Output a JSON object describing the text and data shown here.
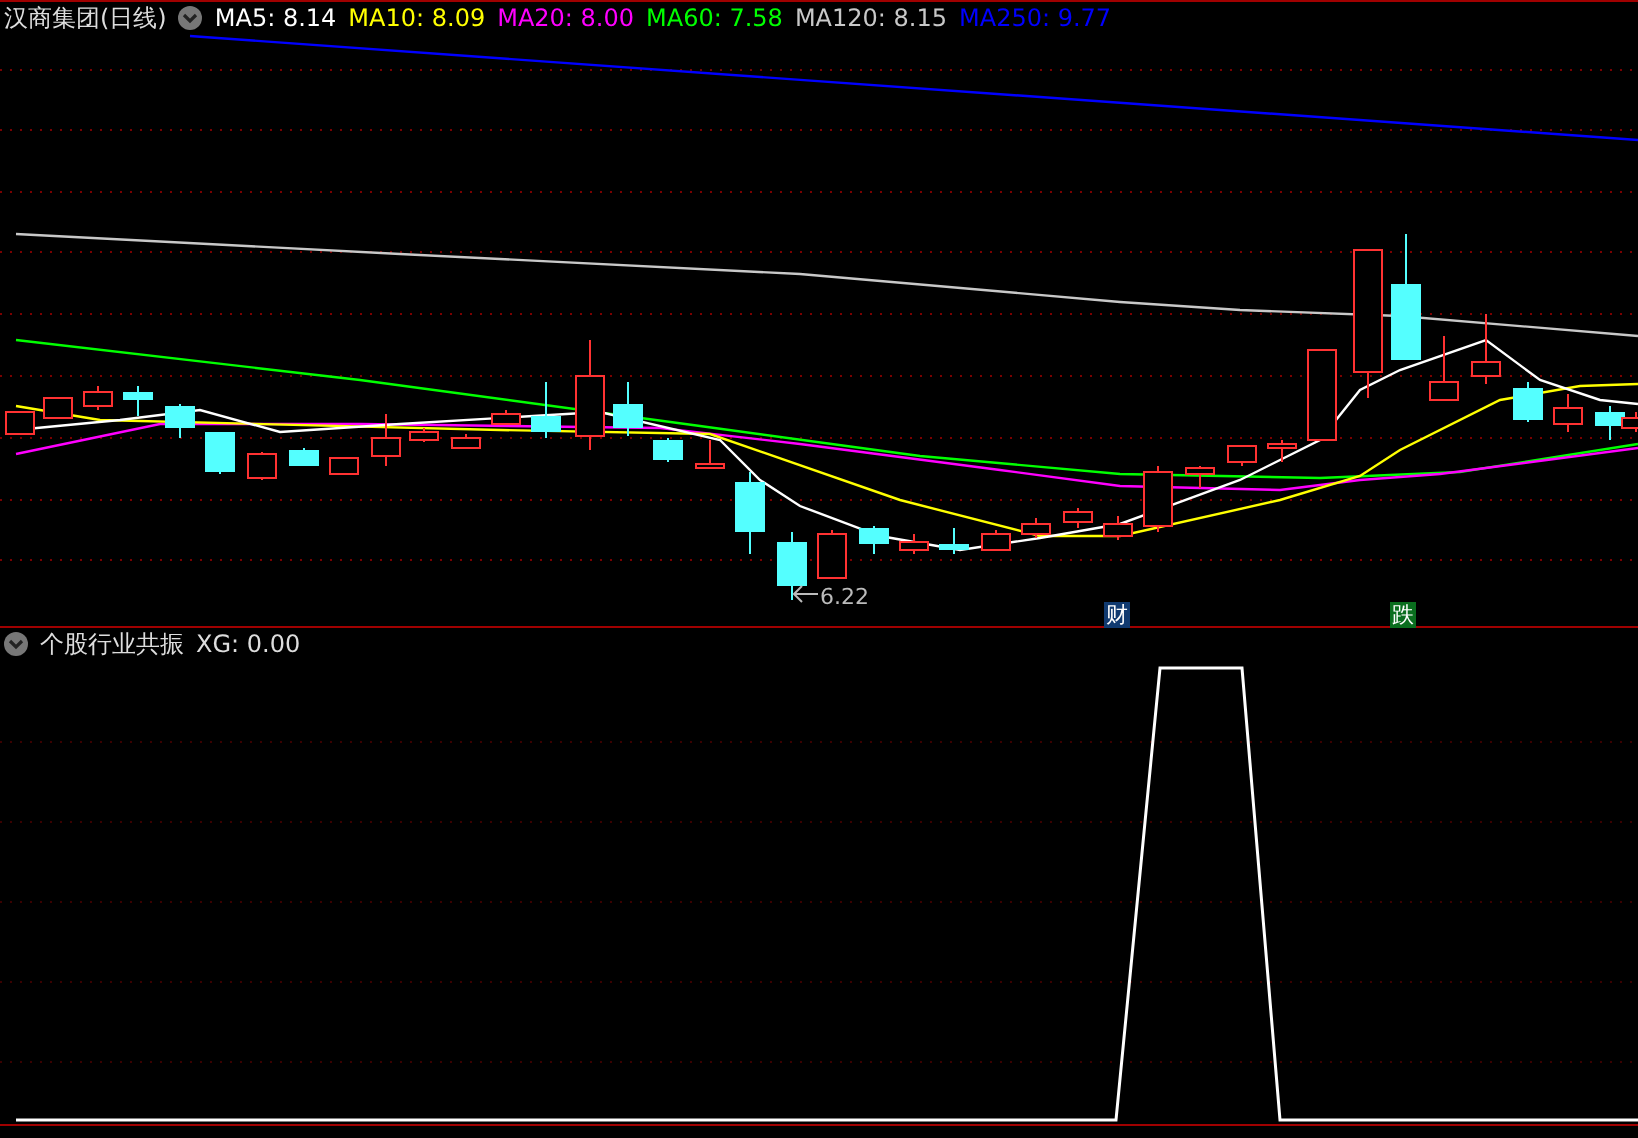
{
  "main_panel": {
    "title": "汉商集团(日线)",
    "moving_averages": [
      {
        "label": "MA5:",
        "value": "8.14",
        "color": "#ffffff"
      },
      {
        "label": "MA10:",
        "value": "8.09",
        "color": "#ffff00"
      },
      {
        "label": "MA20:",
        "value": "8.00",
        "color": "#ff00ff"
      },
      {
        "label": "MA60:",
        "value": "7.58",
        "color": "#00ff00"
      },
      {
        "label": "MA120:",
        "value": "8.15",
        "color": "#c8c8c8"
      },
      {
        "label": "MA250:",
        "value": "9.77",
        "color": "#0000ff"
      }
    ],
    "low_price_label": "6.22",
    "markers": [
      {
        "text": "财",
        "color": "#103a70"
      },
      {
        "text": "跌",
        "color": "#0a6e1e"
      }
    ]
  },
  "indicator_panel": {
    "name": "个股行业共振",
    "reading": "XG: 0.00"
  }
}
